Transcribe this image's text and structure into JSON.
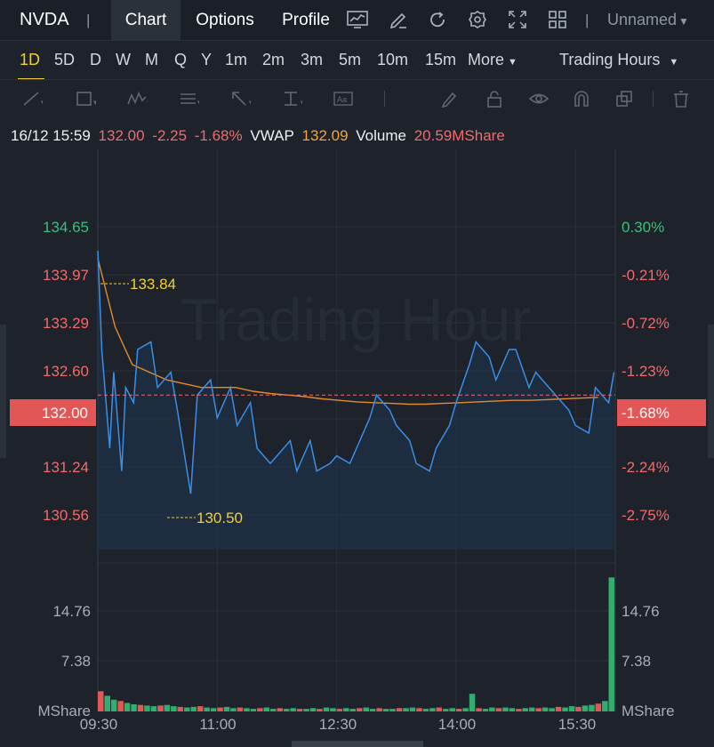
{
  "header": {
    "ticker": "NVDA",
    "tabs": [
      {
        "label": "Chart",
        "active": true
      },
      {
        "label": "Options",
        "active": false
      },
      {
        "label": "Profile",
        "active": false
      }
    ],
    "tool_icons": [
      "chart-line-icon",
      "edit-icon",
      "refresh-icon",
      "settings-icon",
      "expand-icon",
      "grid-icon"
    ],
    "layout_name": "Unnamed"
  },
  "periods": {
    "items": [
      "1D",
      "5D",
      "D",
      "W",
      "M",
      "Q",
      "Y",
      "1m",
      "2m",
      "3m",
      "5m",
      "10m",
      "15m"
    ],
    "active": "1D",
    "more_label": "More",
    "trading_hours_label": "Trading Hours"
  },
  "draw_tools": [
    "line-tool-icon",
    "rectangle-tool-icon",
    "wave-tool-icon",
    "fib-tool-icon",
    "arrow-tool-icon",
    "measure-tool-icon",
    "text-tool-icon",
    "pen-icon",
    "lock-icon",
    "eye-icon",
    "magnet-icon",
    "layers-icon",
    "trash-icon"
  ],
  "info": {
    "datetime": "16/12 15:59",
    "price": "132.00",
    "change": "-2.25",
    "change_pct": "-1.68%",
    "vwap_label": "VWAP",
    "vwap_value": "132.09",
    "volume_label": "Volume",
    "volume_value": "20.59MShare"
  },
  "chart_data": {
    "type": "line",
    "watermark": "Trading Hour",
    "x_ticks": [
      "09:30",
      "11:00",
      "12:30",
      "14:00",
      "15:30"
    ],
    "price_axis": [
      "134.65",
      "133.97",
      "133.29",
      "132.60",
      "131.24",
      "130.56"
    ],
    "pct_axis": [
      "0.30%",
      "-0.21%",
      "-0.72%",
      "-1.23%",
      "-2.24%",
      "-2.75%"
    ],
    "current_price_label": "132.00",
    "current_pct_label": "-1.68%",
    "high_marker": "133.84",
    "low_marker": "130.50",
    "volume_axis": [
      "14.76",
      "7.38"
    ],
    "volume_unit": "MShare",
    "x_minutes": [
      0,
      3,
      6,
      9,
      12,
      15,
      18,
      21,
      24,
      27,
      30,
      35,
      40,
      45,
      50,
      55,
      60,
      65,
      70,
      75,
      80,
      85,
      90,
      95,
      100,
      105,
      110,
      115,
      120,
      125,
      130,
      135,
      140,
      145,
      150,
      155,
      160,
      165,
      170,
      175,
      180,
      185,
      190,
      195,
      200,
      205,
      210,
      215,
      220,
      225,
      230,
      235,
      240,
      245,
      250,
      255,
      260,
      265,
      270,
      275,
      280,
      285,
      290,
      295,
      300,
      305,
      310,
      315,
      320,
      325,
      330,
      335,
      340,
      345,
      350,
      355,
      360,
      365,
      370,
      375,
      380,
      385,
      389
    ],
    "price": [
      133.9,
      132.6,
      131.3,
      132.3,
      131.0,
      132.1,
      131.9,
      132.6,
      132.7,
      132.1,
      132.3,
      131.8,
      130.7,
      132.0,
      132.2,
      131.7,
      132.1,
      131.6,
      131.9,
      131.3,
      131.1,
      131.2,
      131.4,
      131.0,
      131.4,
      131.0,
      131.1,
      131.2,
      131.1,
      131.3,
      131.7,
      132.0,
      131.8,
      131.6,
      131.4,
      131.1,
      131.0,
      131.3,
      131.6,
      131.9,
      132.4,
      132.7,
      132.5,
      132.2,
      132.6,
      132.6,
      132.1,
      132.3,
      132.1,
      132.0,
      131.8,
      131.6,
      131.5,
      132.1,
      131.9,
      132.3
    ],
    "vwap": [
      133.8,
      132.9,
      132.4,
      132.3,
      132.2,
      132.15,
      132.1,
      132.1,
      132.1,
      132.05,
      132.02,
      132.0,
      131.98,
      131.95,
      131.93,
      131.91,
      131.9,
      131.89,
      131.88,
      131.88,
      131.89,
      131.9,
      131.91,
      131.92,
      131.93,
      131.93,
      131.94,
      131.95,
      131.96,
      131.97
    ],
    "vwap_step": 13,
    "ylim": [
      130.2,
      135.0
    ],
    "volume_max": 22.14,
    "volume_bars": [
      3.1,
      2.4,
      1.8,
      1.6,
      1.3,
      1.1,
      1.0,
      0.9,
      0.8,
      0.9,
      1.0,
      0.8,
      0.7,
      0.6,
      0.7,
      0.8,
      0.6,
      0.5,
      0.6,
      0.7,
      0.5,
      0.6,
      0.5,
      0.4,
      0.5,
      0.6,
      0.4,
      0.5,
      0.4,
      0.5,
      0.4,
      0.4,
      0.5,
      0.4,
      0.6,
      0.5,
      0.4,
      0.5,
      0.4,
      0.5,
      0.6,
      0.4,
      0.5,
      0.4,
      0.4,
      0.5,
      0.5,
      0.6,
      0.5,
      0.4,
      0.5,
      0.6,
      0.4,
      0.5,
      0.4,
      0.5,
      2.7,
      0.5,
      0.4,
      0.6,
      0.5,
      0.6,
      0.5,
      0.4,
      0.5,
      0.6,
      0.5,
      0.6,
      0.5,
      0.7,
      0.6,
      0.8,
      0.7,
      0.9,
      1.0,
      1.2,
      1.6,
      20.59
    ]
  }
}
